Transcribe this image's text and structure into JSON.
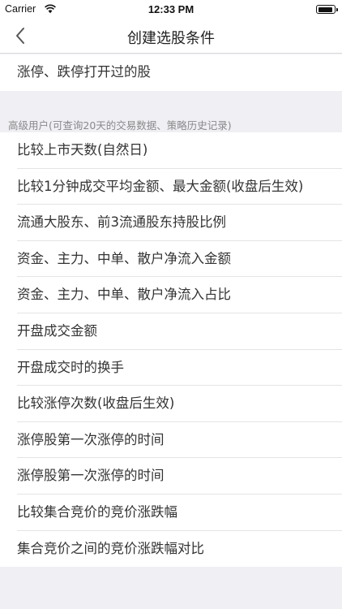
{
  "status_bar": {
    "carrier": "Carrier",
    "time": "12:33 PM",
    "wifi_icon": "wifi-icon",
    "battery_icon": "battery-icon"
  },
  "nav": {
    "title": "创建选股条件",
    "back_icon": "chevron-left-icon"
  },
  "top_item": {
    "label": "涨停、跌停打开过的股"
  },
  "section": {
    "header": "高级用户(可查询20天的交易数据、策略历史记录)",
    "items": [
      {
        "label": "比较上市天数(自然日)"
      },
      {
        "label": "比较1分钟成交平均金额、最大金额(收盘后生效)"
      },
      {
        "label": "流通大股东、前3流通股东持股比例"
      },
      {
        "label": "资金、主力、中单、散户净流入金额"
      },
      {
        "label": "资金、主力、中单、散户净流入占比"
      },
      {
        "label": "开盘成交金额"
      },
      {
        "label": "开盘成交时的换手"
      },
      {
        "label": "比较涨停次数(收盘后生效)"
      },
      {
        "label": "涨停股第一次涨停的时间"
      },
      {
        "label": "涨停股第一次涨停的时间"
      },
      {
        "label": "比较集合竞价的竞价涨跌幅"
      },
      {
        "label": "集合竞价之间的竞价涨跌幅对比"
      }
    ]
  },
  "colors": {
    "background": "#efeff4",
    "row_background": "#ffffff",
    "separator": "#e4e4e4",
    "text": "#333333",
    "section_header_text": "#8a8a8a"
  }
}
